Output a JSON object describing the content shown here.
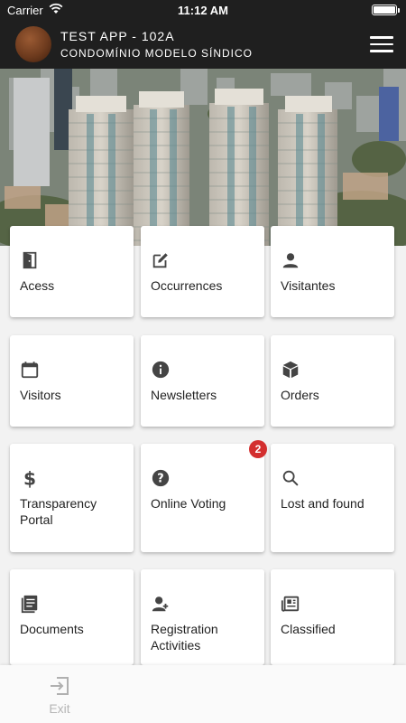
{
  "status_bar": {
    "carrier": "Carrier",
    "time": "11:12 AM"
  },
  "header": {
    "title": "TEST APP - 102A",
    "subtitle": "CONDOMÍNIO MODELO SÍNDICO"
  },
  "colors": {
    "header_bg": "#1f1f1f",
    "badge": "#d32f2f",
    "icon": "#555555"
  },
  "menu": [
    {
      "label": "Acess",
      "icon": "door-icon"
    },
    {
      "label": "Occurrences",
      "icon": "edit-icon"
    },
    {
      "label": "Visitantes",
      "icon": "person-icon"
    },
    {
      "label": "Visitors",
      "icon": "calendar-icon"
    },
    {
      "label": "Newsletters",
      "icon": "info-icon"
    },
    {
      "label": "Orders",
      "icon": "box-icon"
    },
    {
      "label": "Transparency Portal",
      "icon": "dollar-icon"
    },
    {
      "label": "Online Voting",
      "icon": "question-icon",
      "badge": "2"
    },
    {
      "label": "Lost and found",
      "icon": "search-icon"
    },
    {
      "label": "Documents",
      "icon": "document-icon"
    },
    {
      "label": "Registration Activities",
      "icon": "person-add-icon"
    },
    {
      "label": "Classified",
      "icon": "newspaper-icon"
    }
  ],
  "bottom_bar": {
    "exit_label": "Exit",
    "exit_icon": "exit-icon"
  }
}
